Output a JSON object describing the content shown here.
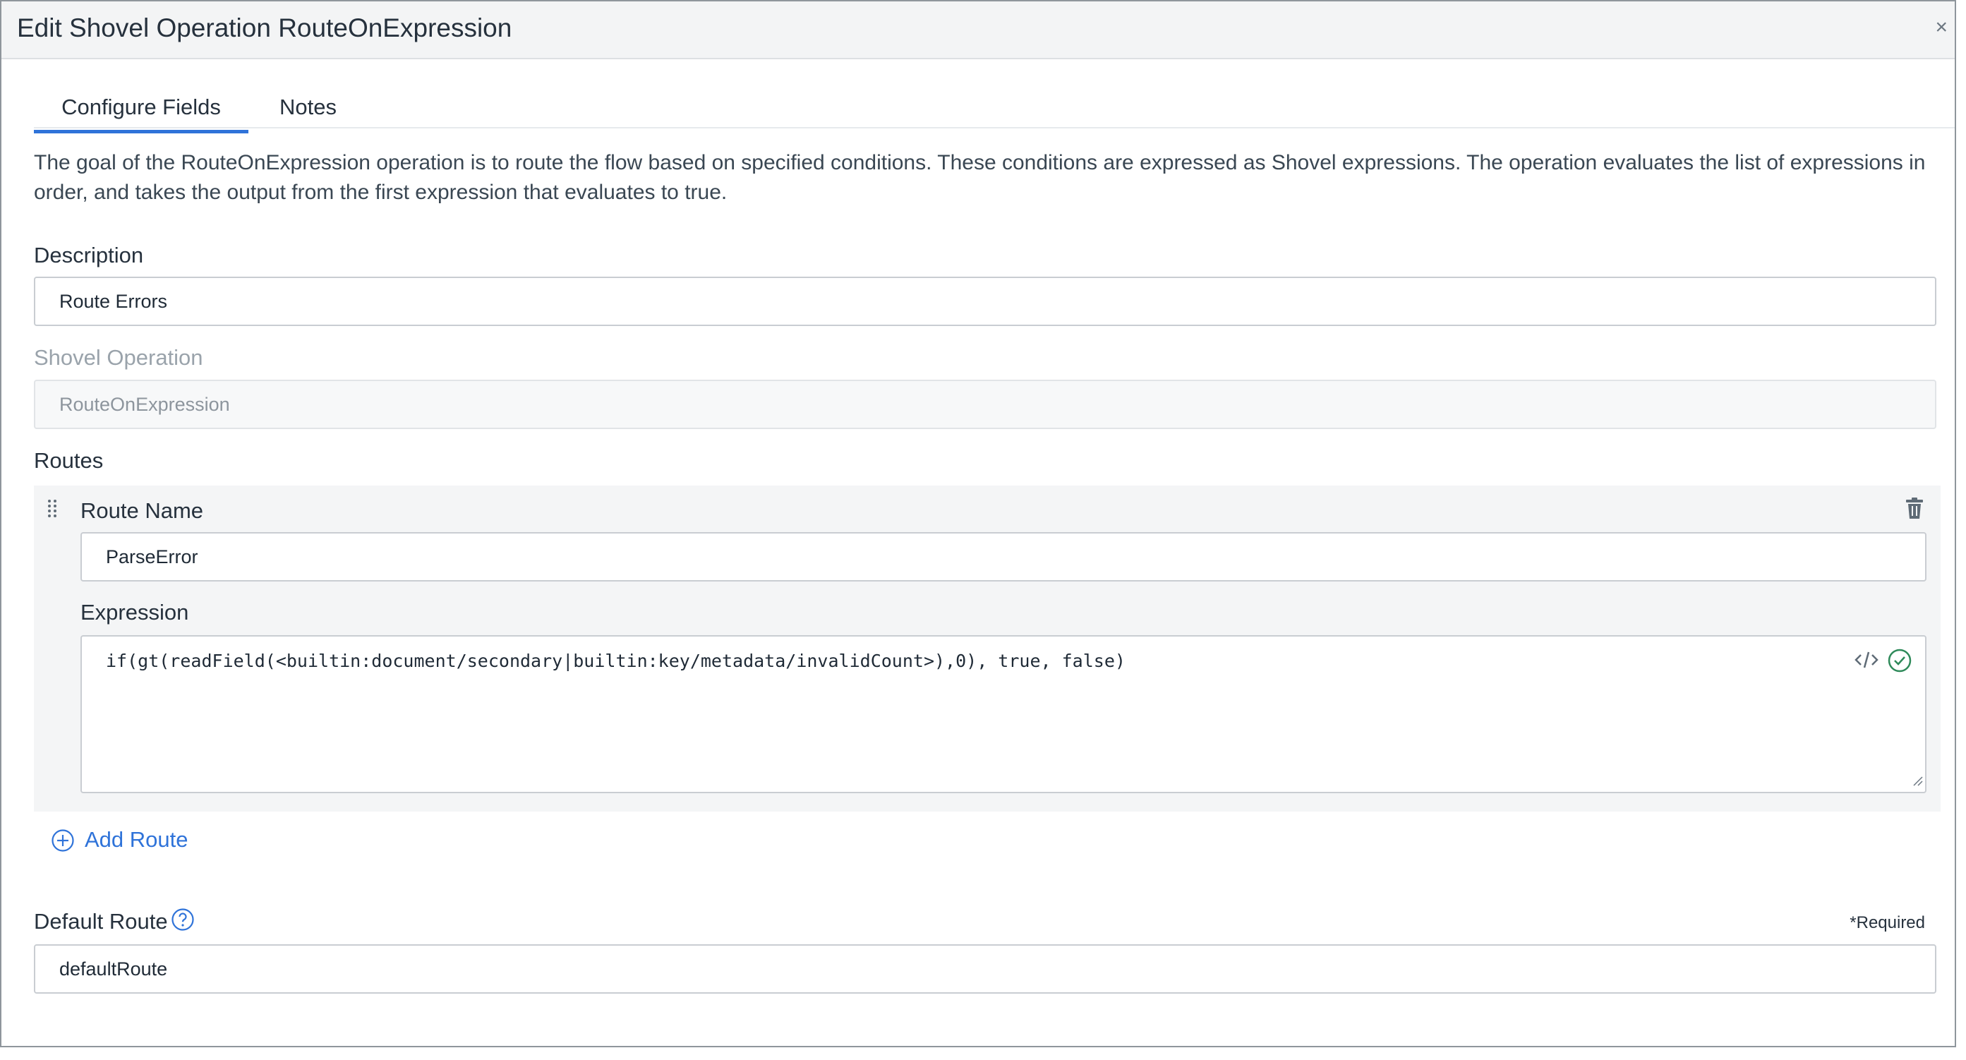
{
  "dialog": {
    "title": "Edit Shovel Operation RouteOnExpression",
    "close_glyph": "×"
  },
  "tabs": [
    {
      "label": "Configure Fields",
      "active": true
    },
    {
      "label": "Notes",
      "active": false
    }
  ],
  "intro_text": "The goal of the RouteOnExpression operation is to route the flow based on specified conditions. These conditions are expressed as Shovel expressions. The operation evaluates the list of expressions in order, and takes the output from the first expression that evaluates to true.",
  "description": {
    "label": "Description",
    "value": "Route Errors"
  },
  "shovel_operation": {
    "label": "Shovel Operation",
    "value": "RouteOnExpression"
  },
  "routes": {
    "label": "Routes",
    "items": [
      {
        "route_name_label": "Route Name",
        "route_name_value": "ParseError",
        "expression_label": "Expression",
        "expression_value": "if(gt(readField(<builtin:document/secondary|builtin:key/metadata/invalidCount>),0), true, false)"
      }
    ],
    "add_route_label": "Add Route"
  },
  "default_route": {
    "label": "Default Route",
    "required_note": "*Required",
    "value": "defaultRoute"
  },
  "colors": {
    "accent": "#2f73d9",
    "valid": "#2f8a5a",
    "header_bg": "#f3f4f5"
  },
  "icons": [
    "close-icon",
    "drag-handle-icon",
    "trash-icon",
    "code-icon",
    "check-circle-icon",
    "plus-circle-icon",
    "help-icon",
    "resize-handle-icon"
  ]
}
